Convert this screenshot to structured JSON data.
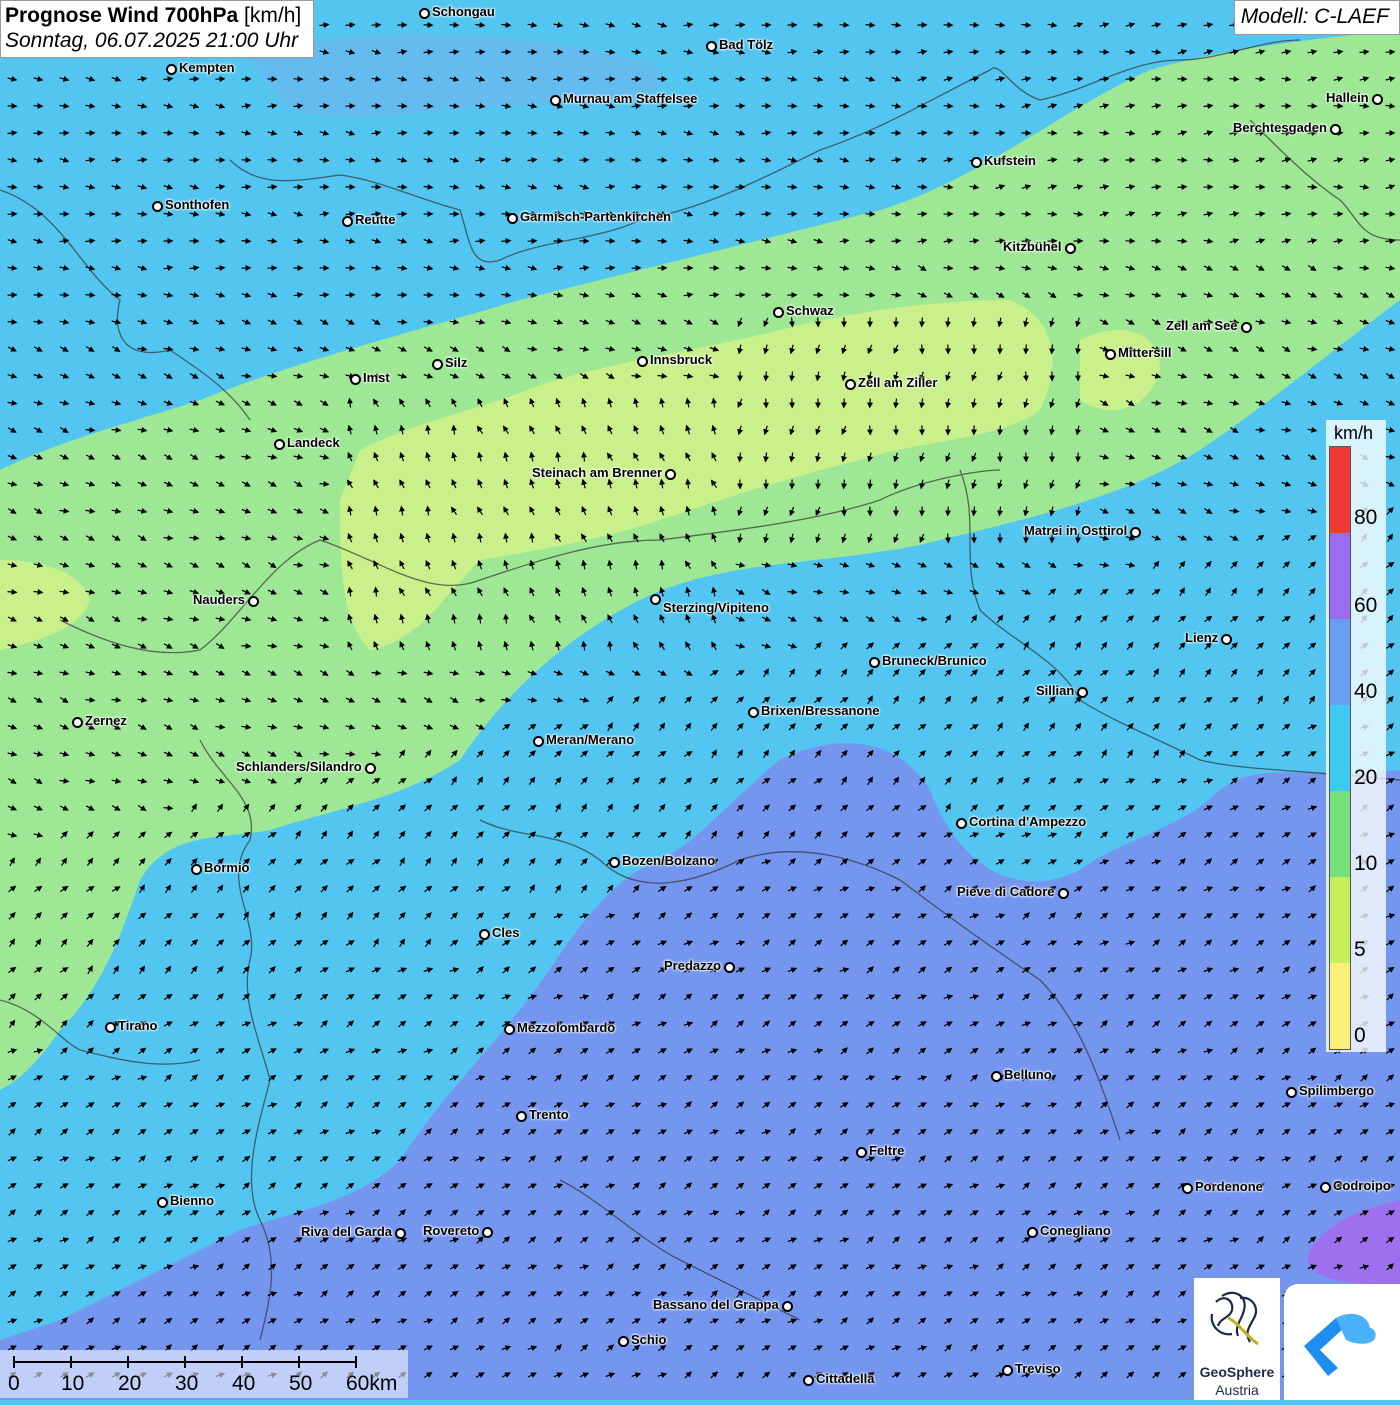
{
  "header": {
    "title_bold": "Prognose Wind 700hPa",
    "title_unit": "[km/h]",
    "date": "Sonntag, 06.07.2025 21:00 Uhr",
    "model": "Modell: C-LAEF"
  },
  "legend": {
    "unit": "km/h",
    "ticks": [
      "80",
      "60",
      "40",
      "20",
      "10",
      "5",
      "0"
    ],
    "colors": [
      "#f03a3a",
      "#9c6cf0",
      "#6a9cf0",
      "#3ccaf0",
      "#78e07a",
      "#c6f05a",
      "#f8f078"
    ]
  },
  "scale": {
    "labels": [
      "0",
      "10",
      "20",
      "30",
      "40",
      "50",
      "60km"
    ]
  },
  "logos": {
    "geosphere_line1": "GeoSphere",
    "geosphere_line2": "Austria"
  },
  "zones": {
    "blue": "#52c6f0",
    "green": "#9ee895",
    "yellowgreen": "#c9f08a",
    "violet": "#7496ef",
    "purple": "#9c70ee",
    "paleblue": "#8ca6ef"
  },
  "cities": [
    {
      "name": "Schongau"
    },
    {
      "name": "Bad Tölz"
    },
    {
      "name": "Kempten"
    },
    {
      "name": "Murnau am Staffelsee"
    },
    {
      "name": "Hallein"
    },
    {
      "name": "Berchtesgaden"
    },
    {
      "name": "Kufstein"
    },
    {
      "name": "Sonthofen"
    },
    {
      "name": "Reutte"
    },
    {
      "name": "Garmisch-Partenkirchen"
    },
    {
      "name": "Kitzbühel"
    },
    {
      "name": "Schwaz"
    },
    {
      "name": "Zell am See"
    },
    {
      "name": "Mittersill"
    },
    {
      "name": "Innsbruck"
    },
    {
      "name": "Silz"
    },
    {
      "name": "Imst"
    },
    {
      "name": "Zell am Ziller"
    },
    {
      "name": "Landeck"
    },
    {
      "name": "Steinach am Brenner"
    },
    {
      "name": "Matrei in Osttirol"
    },
    {
      "name": "Nauders"
    },
    {
      "name": "Sterzing/Vipiteno"
    },
    {
      "name": "Lienz"
    },
    {
      "name": "Bruneck/Brunico"
    },
    {
      "name": "Sillian"
    },
    {
      "name": "Zernez"
    },
    {
      "name": "Brixen/Bressanone"
    },
    {
      "name": "Meran/Merano"
    },
    {
      "name": "Schlanders/Silandro"
    },
    {
      "name": "Cortina d'Ampezzo"
    },
    {
      "name": "Bormio"
    },
    {
      "name": "Bozen/Bolzano"
    },
    {
      "name": "Pieve di Cadore"
    },
    {
      "name": "Cles"
    },
    {
      "name": "Predazzo"
    },
    {
      "name": "Tirano"
    },
    {
      "name": "Mezzolombardo"
    },
    {
      "name": "Belluno"
    },
    {
      "name": "Spilimbergo"
    },
    {
      "name": "Trento"
    },
    {
      "name": "Feltre"
    },
    {
      "name": "Pordenone"
    },
    {
      "name": "Codroipo"
    },
    {
      "name": "Bienno"
    },
    {
      "name": "Riva del Garda"
    },
    {
      "name": "Rovereto"
    },
    {
      "name": "Conegliano"
    },
    {
      "name": "Bassano del Grappa"
    },
    {
      "name": "Schio"
    },
    {
      "name": "Treviso"
    },
    {
      "name": "Cittadella"
    }
  ]
}
